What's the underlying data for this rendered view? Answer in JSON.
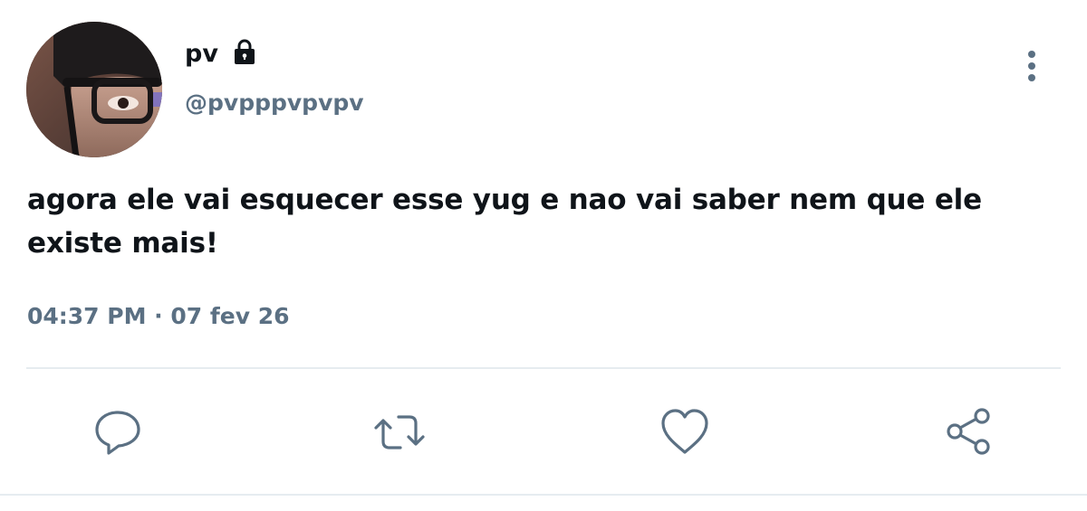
{
  "tweet": {
    "display_name": "pv",
    "handle": "@pvpppvpvpv",
    "text": "agora ele vai esquecer esse yug e nao vai saber nem que ele existe mais!",
    "timestamp": "04:37 PM · 07 fev 26",
    "protected": true
  },
  "icons": {
    "lock": "lock-icon",
    "more": "more-vertical-icon",
    "reply": "reply-icon",
    "retweet": "retweet-icon",
    "like": "heart-icon",
    "share": "share-icon"
  },
  "colors": {
    "text": "#0f1419",
    "secondary": "#5b7083",
    "divider": "#e6ecf0"
  }
}
